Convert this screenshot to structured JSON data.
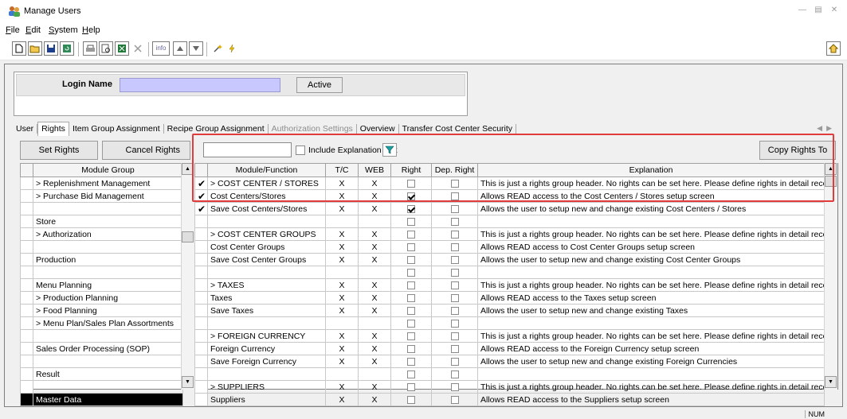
{
  "window": {
    "title": "Manage Users"
  },
  "menu": [
    {
      "label": "File",
      "u": "F",
      "rest": "ile"
    },
    {
      "label": "Edit",
      "u": "E",
      "rest": "dit"
    },
    {
      "label": "System",
      "u": "S",
      "rest": "ystem"
    },
    {
      "label": "Help",
      "u": "H",
      "rest": "elp"
    }
  ],
  "toolbar": {
    "info_label": "info"
  },
  "login": {
    "label": "Login Name",
    "value": "",
    "active_label": "Active"
  },
  "tabs": [
    {
      "label": "User"
    },
    {
      "label": "Rights",
      "selected": true
    },
    {
      "label": "Item Group Assignment"
    },
    {
      "label": "Recipe Group Assignment"
    },
    {
      "label": "Authorization Settings",
      "disabled": true
    },
    {
      "label": "Overview"
    },
    {
      "label": "Transfer Cost Center Security"
    }
  ],
  "actions": {
    "set_rights": "Set Rights",
    "cancel_rights": "Cancel Rights",
    "include_explanation": "Include Explanation text",
    "copy_rights": "Copy Rights To",
    "search_value": ""
  },
  "module_table": {
    "header": "Module Group",
    "rows": [
      "> Replenishment Management",
      "> Purchase Bid Management",
      "",
      "Store",
      "> Authorization",
      "",
      "Production",
      "",
      "Menu Planning",
      "> Production Planning",
      "> Food Planning",
      "> Menu Plan/Sales Plan Assortments",
      "",
      "Sales Order Processing (SOP)",
      "",
      "Result",
      "",
      "Master Data"
    ],
    "selected_row": 17
  },
  "rights_table": {
    "headers": [
      "Module/Function",
      "T/C",
      "WEB",
      "Right",
      "Dep. Right",
      "Explanation"
    ],
    "rows": [
      {
        "tick": true,
        "name": "> COST CENTER / STORES",
        "tc": "X",
        "web": "X",
        "right": false,
        "dep": false,
        "expl": "This is just a rights group header. No rights can be set here. Please define rights in detail records b"
      },
      {
        "tick": true,
        "name": "Cost Centers/Stores",
        "tc": "X",
        "web": "X",
        "right": true,
        "dep": false,
        "expl": "Allows READ access to the Cost Centers / Stores setup screen"
      },
      {
        "tick": true,
        "name": "Save Cost Centers/Stores",
        "tc": "X",
        "web": "X",
        "right": true,
        "dep": false,
        "expl": "Allows the user to setup new and change existing Cost Centers / Stores"
      },
      {
        "tick": false,
        "name": "",
        "tc": "",
        "web": "",
        "right": false,
        "dep": false,
        "expl": ""
      },
      {
        "tick": false,
        "name": "> COST CENTER GROUPS",
        "tc": "X",
        "web": "X",
        "right": false,
        "dep": false,
        "expl": "This is just a rights group header. No rights can be set here. Please define rights in detail records b"
      },
      {
        "tick": false,
        "name": "Cost Center Groups",
        "tc": "X",
        "web": "X",
        "right": false,
        "dep": false,
        "expl": "Allows READ access to Cost Center Groups setup screen"
      },
      {
        "tick": false,
        "name": "Save Cost Center Groups",
        "tc": "X",
        "web": "X",
        "right": false,
        "dep": false,
        "expl": "Allows the user to setup new and change existing Cost Center Groups"
      },
      {
        "tick": false,
        "name": "",
        "tc": "",
        "web": "",
        "right": false,
        "dep": false,
        "expl": ""
      },
      {
        "tick": false,
        "name": "> TAXES",
        "tc": "X",
        "web": "X",
        "right": false,
        "dep": false,
        "expl": "This is just a rights group header. No rights can be set here. Please define rights in detail records b"
      },
      {
        "tick": false,
        "name": "Taxes",
        "tc": "X",
        "web": "X",
        "right": false,
        "dep": false,
        "expl": "Allows READ access to the Taxes setup screen"
      },
      {
        "tick": false,
        "name": "Save Taxes",
        "tc": "X",
        "web": "X",
        "right": false,
        "dep": false,
        "expl": "Allows the user to setup new and change existing Taxes"
      },
      {
        "tick": false,
        "name": "",
        "tc": "",
        "web": "",
        "right": false,
        "dep": false,
        "expl": ""
      },
      {
        "tick": false,
        "name": "> FOREIGN CURRENCY",
        "tc": "X",
        "web": "X",
        "right": false,
        "dep": false,
        "expl": "This is just a rights group header. No rights can be set here. Please define rights in detail records b"
      },
      {
        "tick": false,
        "name": "Foreign Currency",
        "tc": "X",
        "web": "X",
        "right": false,
        "dep": false,
        "expl": "Allows READ access to the Foreign Currency setup screen"
      },
      {
        "tick": false,
        "name": "Save Foreign Currency",
        "tc": "X",
        "web": "X",
        "right": false,
        "dep": false,
        "expl": "Allows the user to setup new and change existing Foreign Currencies"
      },
      {
        "tick": false,
        "name": "",
        "tc": "",
        "web": "",
        "right": false,
        "dep": false,
        "expl": ""
      },
      {
        "tick": false,
        "name": "> SUPPLIERS",
        "tc": "X",
        "web": "X",
        "right": false,
        "dep": false,
        "expl": "This is just a rights group header. No rights can be set here. Please define rights in detail records b"
      },
      {
        "tick": false,
        "name": "Suppliers",
        "tc": "X",
        "web": "X",
        "right": false,
        "dep": false,
        "expl": "Allows READ access to the Suppliers setup screen"
      }
    ]
  },
  "status": {
    "num": "NUM"
  },
  "colors": {
    "login_input": "#c8c8ff",
    "highlight": "#e23b3b",
    "selected_row": "#000000"
  }
}
